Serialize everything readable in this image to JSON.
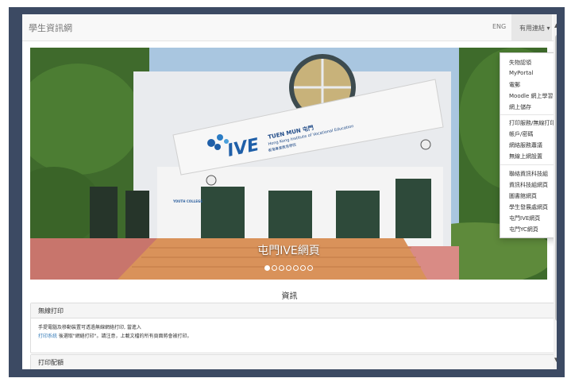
{
  "header": {
    "brand": "學生資訊網",
    "lang": "ENG",
    "links_menu": "有用連結 ▾"
  },
  "dropdown": {
    "group1": [
      "失物認領",
      "MyPortal",
      "電郵",
      "Moodle 網上學習平台",
      "網上儲存"
    ],
    "group2": [
      "打印服務/無線打印",
      "帳戶/密碼",
      "網絡服務蕭議",
      "無線上網設置"
    ],
    "group3": [
      "聯絡資訊科技組",
      "資訊科技組網頁",
      "圖書館網頁",
      "學生發展處網頁",
      "屯門IVE網頁",
      "屯門YC網頁"
    ]
  },
  "hero": {
    "caption": "屯門IVE網頁",
    "slide_count": 7,
    "active_slide": 1,
    "building_text": {
      "logo": "IVE",
      "campus": "TUEN MUN 屯門",
      "institute": "Hong Kong Institute of Vocational Education",
      "institute_zh": "香港專業教育學院",
      "youth_sign": "YOUTH COLLEGE"
    }
  },
  "section": {
    "title": "資訊"
  },
  "panels": [
    {
      "title": "無線打印",
      "line1": "手提電腦及移動裝置可透過無線網絡打印, 當進入",
      "link": "打印系統",
      "line2_rest": " 後選取\"網絡打印\"。請注意，上載文檔的所有頁面將會被打印。"
    },
    {
      "title": "打印配額"
    }
  ],
  "colors": {
    "frame": "#3c4a63",
    "link": "#337ab7",
    "navbar": "#f8f8f8"
  }
}
